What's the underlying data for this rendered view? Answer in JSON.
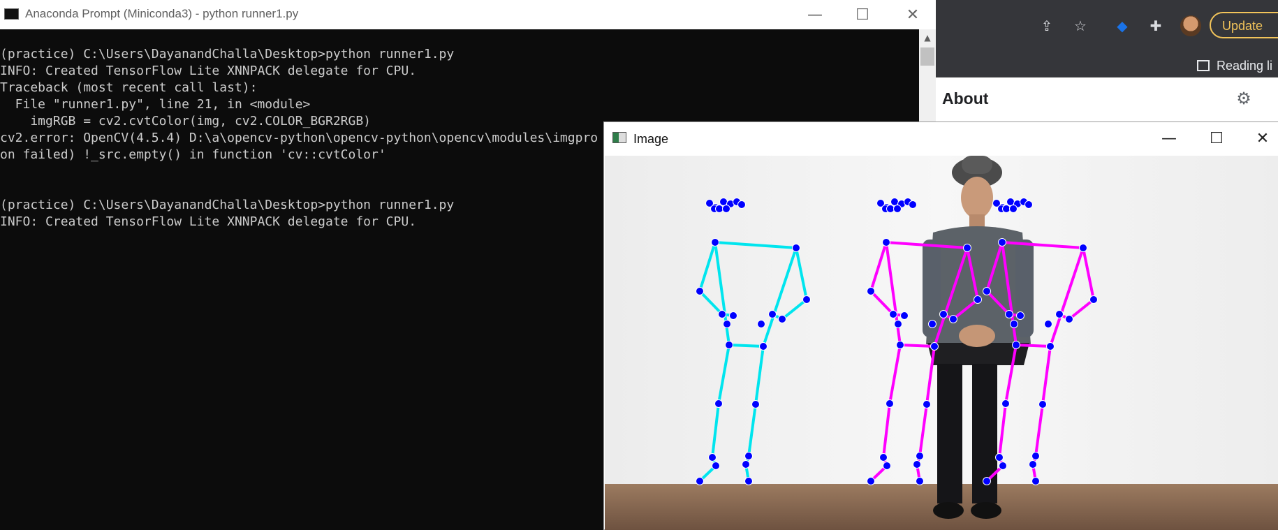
{
  "browser": {
    "update_label": "Update",
    "reading_list_label": "Reading li",
    "panel_title": "About",
    "icons": [
      "share-icon",
      "star-icon",
      "extension-gem-icon",
      "puzzle-icon",
      "profile-avatar",
      "reading-list-icon",
      "gear-icon"
    ]
  },
  "console": {
    "title": "Anaconda Prompt (Miniconda3) - python  runner1.py",
    "lines": [
      "(practice) C:\\Users\\DayanandChalla\\Desktop>python runner1.py",
      "INFO: Created TensorFlow Lite XNNPACK delegate for CPU.",
      "Traceback (most recent call last):",
      "  File \"runner1.py\", line 21, in <module>",
      "    imgRGB = cv2.cvtColor(img, cv2.COLOR_BGR2RGB)",
      "cv2.error: OpenCV(4.5.4) D:\\a\\opencv-python\\opencv-python\\opencv\\modules\\imgpro",
      "on failed) !_src.empty() in function 'cv::cvtColor'",
      "",
      "",
      "(practice) C:\\Users\\DayanandChalla\\Desktop>python runner1.py",
      "INFO: Created TensorFlow Lite XNNPACK delegate for CPU."
    ]
  },
  "image_window": {
    "title": "Image",
    "colors": {
      "left_skeleton": "#00e5ee",
      "pose_skeleton": "#ff00ff",
      "landmark": "#0000ff",
      "wall": "#f2f2f2",
      "floor": "#8a6a50"
    }
  }
}
